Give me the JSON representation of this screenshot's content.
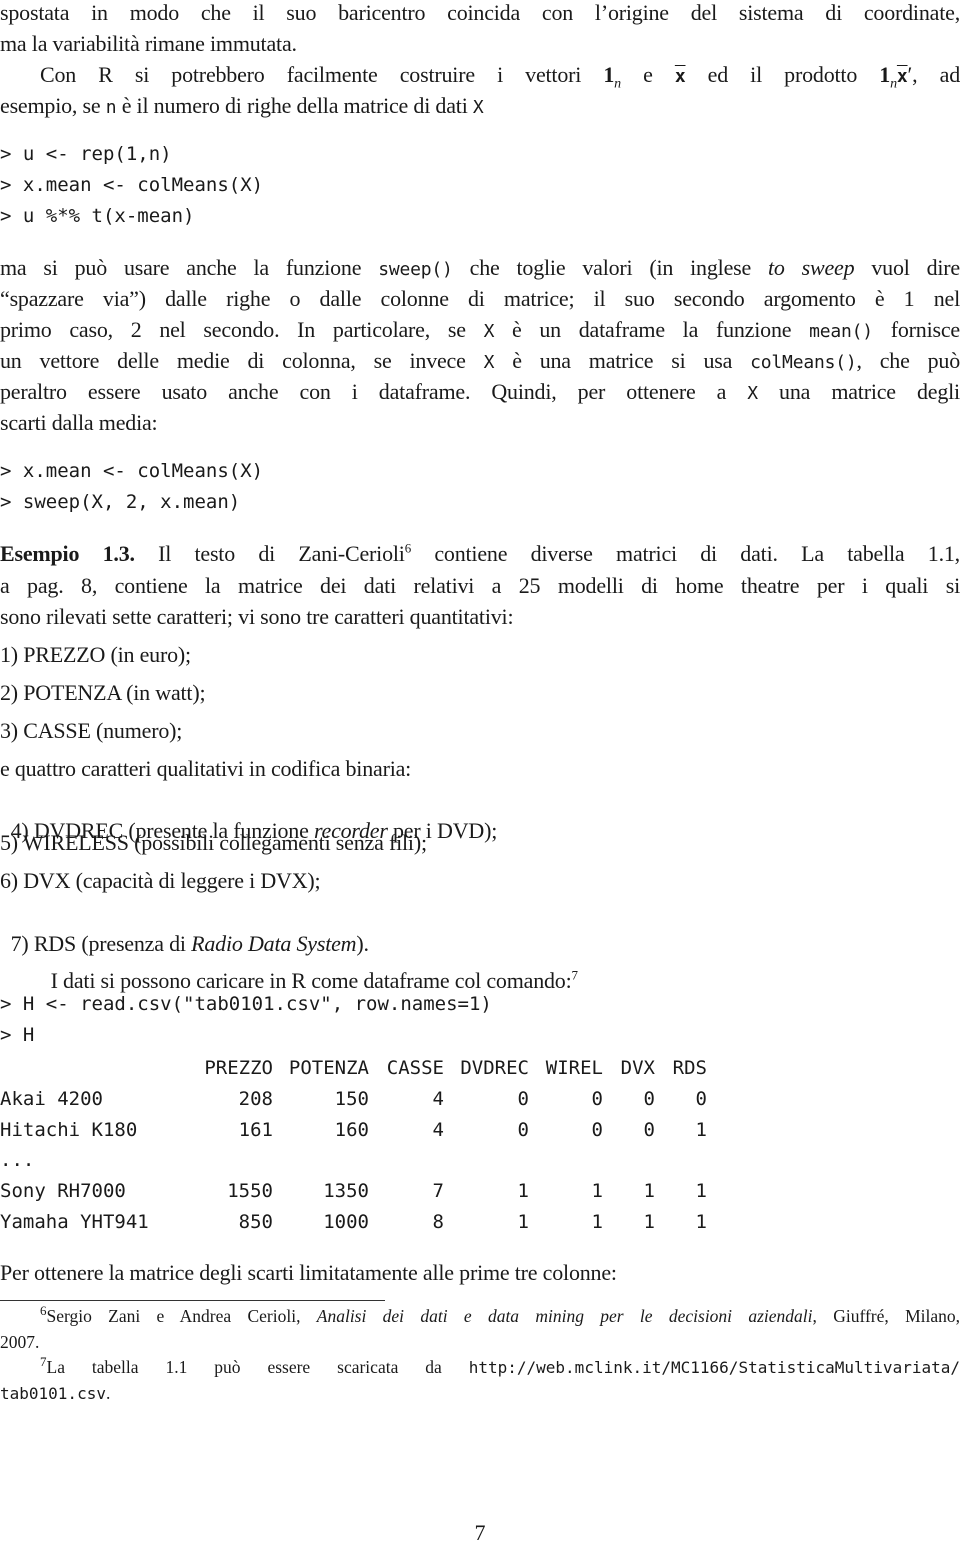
{
  "intro": {
    "line1": "spostata in modo che il suo baricentro coincida con l’origine del sistema di coordinate,",
    "line2": "ma la variabilità rimane immutata.",
    "line3_a": "Con R si potrebbero facilmente costruire i vettori ",
    "line3_b": " e ",
    "line3_c": " ed il prodotto ",
    "line3_d": ", ad",
    "vec_one": "1",
    "sub_n": "n",
    "xbar": "x",
    "prime": "′",
    "line4_a": "esempio, se ",
    "line4_code1": "n",
    "line4_b": " è il numero di righe della matrice di dati ",
    "line4_code2": "X"
  },
  "code1": [
    "> u <- rep(1,n)",
    "> x.mean <- colMeans(X)",
    "> u %*% t(x-mean)"
  ],
  "para2": {
    "l1_a": "ma si può usare anche la funzione ",
    "l1_code": "sweep()",
    "l1_b": " che toglie valori (in inglese ",
    "l1_it": "to sweep",
    "l1_c": " vuol dire",
    "l2": "“spazzare via”) dalle righe o dalle colonne di matrice; il suo secondo argomento è 1 nel",
    "l3_a": "primo caso, 2 nel secondo. In particolare, se ",
    "l3_code1": "X",
    "l3_b": " è un dataframe la funzione ",
    "l3_code2": "mean()",
    "l3_c": " fornisce",
    "l4_a": "un vettore delle medie di colonna, se invece ",
    "l4_code1": "X",
    "l4_b": " è una matrice si usa ",
    "l4_code2": "colMeans()",
    "l4_c": ", che può",
    "l5_a": "peraltro essere usato anche con i dataframe. Quindi, per ottenere a ",
    "l5_code": "X",
    "l5_b": " una matrice degli",
    "l6": "scarti dalla media:"
  },
  "code2": [
    "> x.mean <- colMeans(X)",
    "> sweep(X, 2, x.mean)"
  ],
  "example": {
    "label": "Esempio 1.3.",
    "l1_a": " Il testo di Zani-Cerioli",
    "fn_ref": "6",
    "l1_b": " contiene diverse matrici di dati. La tabella 1.1,",
    "l2": "a pag. 8, contiene la matrice dei dati relativi a 25 modelli di home theatre per i quali si",
    "l3": "sono rilevati sette caratteri; vi sono tre caratteri quantitativi:",
    "items": [
      {
        "text": "1) PREZZO (in euro);"
      },
      {
        "text": "2) POTENZA (in watt);"
      },
      {
        "text": "3) CASSE (numero);"
      }
    ],
    "qual_intro": "e quattro caratteri qualitativi in codifica binaria:",
    "item4_a": "4) DVDREC (presente la funzione ",
    "item4_it": "recorder",
    "item4_b": " per i DVD);",
    "item5": "5) WIRELESS (possibili collegamenti senza fili);",
    "item6": "6) DVX (capacità di leggere i DVX);",
    "item7_a": "7) RDS (presenza di ",
    "item7_it": "Radio Data System",
    "item7_b": ").",
    "load_text": "I dati si possono caricare in R come dataframe col comando:",
    "fn_ref2": "7"
  },
  "code3": [
    "> H <- read.csv(\"tab0101.csv\", row.names=1)",
    "> H"
  ],
  "table": {
    "headers": [
      "",
      "PREZZO",
      "POTENZA",
      "CASSE",
      "DVDREC",
      "WIREL",
      "DVX",
      "RDS"
    ],
    "rows": [
      [
        "Akai 4200",
        "208",
        "150",
        "4",
        "0",
        "0",
        "0",
        "0"
      ],
      [
        "Hitachi K180",
        "161",
        "160",
        "4",
        "0",
        "0",
        "0",
        "1"
      ],
      [
        "...",
        "",
        "",
        "",
        "",
        "",
        "",
        ""
      ],
      [
        "Sony RH7000",
        "1550",
        "1350",
        "7",
        "1",
        "1",
        "1",
        "1"
      ],
      [
        "Yamaha YHT941",
        "850",
        "1000",
        "8",
        "1",
        "1",
        "1",
        "1"
      ]
    ]
  },
  "closing": "Per ottenere la matrice degli scarti limitatamente alle prime tre colonne:",
  "footnotes": {
    "fn6_num": "6",
    "fn6_a": "Sergio Zani e Andrea Cerioli, ",
    "fn6_it": "Analisi dei dati e data mining per le decisioni aziendali",
    "fn6_b": ", Giuffré, Milano,",
    "fn6_c": "2007.",
    "fn7_num": "7",
    "fn7_a": "La tabella 1.1 può essere scaricata da ",
    "fn7_url1": "http://web.mclink.it/MC1166/StatisticaMultivariata/",
    "fn7_url2": "tab0101.csv",
    "fn7_b": "."
  },
  "page_number": "7"
}
